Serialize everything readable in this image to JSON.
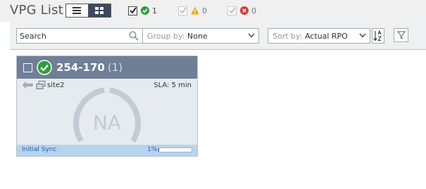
{
  "header": {
    "title": "VPG List",
    "view_toggle": {
      "options": [
        "list",
        "grid"
      ],
      "selected": "grid"
    },
    "filters": [
      {
        "name": "ok",
        "checked": true,
        "count": "1",
        "icon": "check-circle-icon",
        "color": "#2e9e3a"
      },
      {
        "name": "warning",
        "checked": true,
        "count": "0",
        "icon": "warning-triangle-icon",
        "color": "#f0a30a"
      },
      {
        "name": "error",
        "checked": true,
        "count": "0",
        "icon": "error-circle-icon",
        "color": "#d93b3b"
      }
    ]
  },
  "toolbar": {
    "search": {
      "placeholder": "Search"
    },
    "group_by": {
      "label": "Group by:",
      "value": "None"
    },
    "sort_by": {
      "label": "Sort by:",
      "value": "Actual RPO"
    }
  },
  "vpgs": [
    {
      "name": "254-170",
      "count": "(1)",
      "status_color": "#2e9e3a",
      "site": "site2",
      "sla": "SLA: 5 min",
      "rpo": "NA",
      "status_text": "Initial Sync",
      "progress_label": "1%",
      "progress": 0.01
    }
  ],
  "colors": {
    "card_header": "#6e7f97",
    "card_footer": "#b7d3ed",
    "accent": "#1b63b0"
  }
}
